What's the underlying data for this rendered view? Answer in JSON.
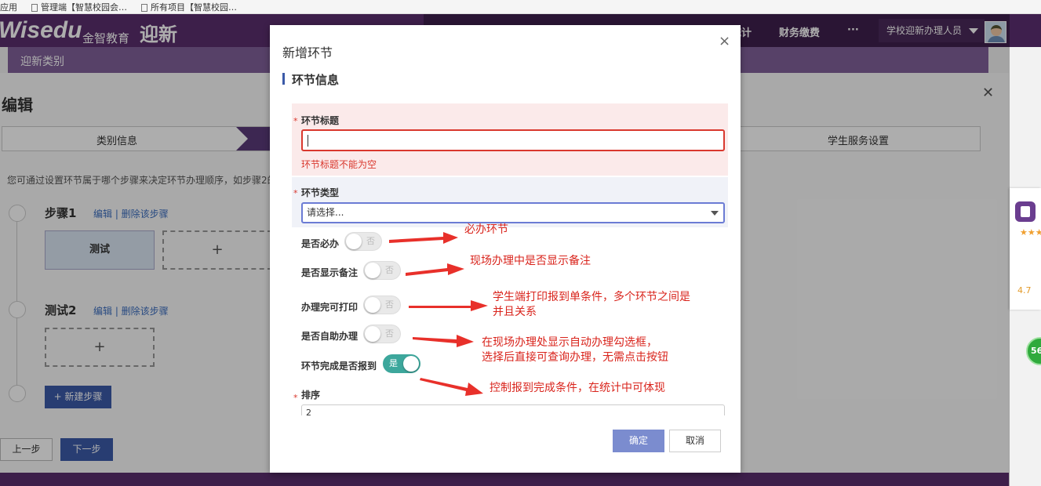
{
  "bookmarks": {
    "apps": "应用",
    "item1": "管理端【智慧校园会…",
    "item2": "所有项目【智慧校园…"
  },
  "header": {
    "logo": "Wisedu",
    "logo_cn": "金智教育",
    "app_name": "迎新",
    "nav_stats": "统计",
    "nav_finance": "财务缴费",
    "nav_more": "···",
    "role": "学校迎新办理人员"
  },
  "subbar": {
    "title": "迎新类别"
  },
  "editor": {
    "title": "编辑",
    "tabs": [
      "类别信息",
      "学生服务设置"
    ],
    "hint": "您可通过设置环节属于哪个步骤来决定环节办理顺序，如步骤2的",
    "steps": [
      {
        "name": "步骤1",
        "ops": "编辑 | 删除该步骤",
        "item": "测试"
      },
      {
        "name": "测试2",
        "ops": "编辑 | 删除该步骤"
      }
    ],
    "plus": "+",
    "new_step": "+ 新建步骤",
    "prev": "上一步",
    "next": "下一步"
  },
  "rating": {
    "stars": "★★★★☆",
    "score": "4.7"
  },
  "badge": {
    "value": "56"
  },
  "modal": {
    "title": "新增环节",
    "close": "×",
    "section": "环节信息",
    "required_mark": "*",
    "fields": {
      "title_label": "环节标题",
      "title_error": "环节标题不能为空",
      "type_label": "环节类型",
      "type_placeholder": "请选择...",
      "required_label": "是否必办",
      "show_note_label": "是否显示备注",
      "printable_label": "办理完可打印",
      "self_service_label": "是否自助办理",
      "report_label": "环节完成是否报到",
      "order_label": "排序",
      "order_value": "2"
    },
    "toggles": {
      "off_text": "否",
      "on_text": "是",
      "required": false,
      "show_note": false,
      "printable": false,
      "self_service": false,
      "report": true
    },
    "ok": "确定",
    "cancel": "取消"
  },
  "annotations": {
    "a1": "必办环节",
    "a2": "现场办理中是否显示备注",
    "a3_line1": "学生端打印报到单条件，多个环节之间是",
    "a3_line2": "并且关系",
    "a4_line1": "在现场办理处显示自动办理勾选框，",
    "a4_line2": "选择后直接可查询办理，无需点击按钮",
    "a5": "控制报到完成条件，在统计中可体现",
    "color": "#d9241c"
  }
}
